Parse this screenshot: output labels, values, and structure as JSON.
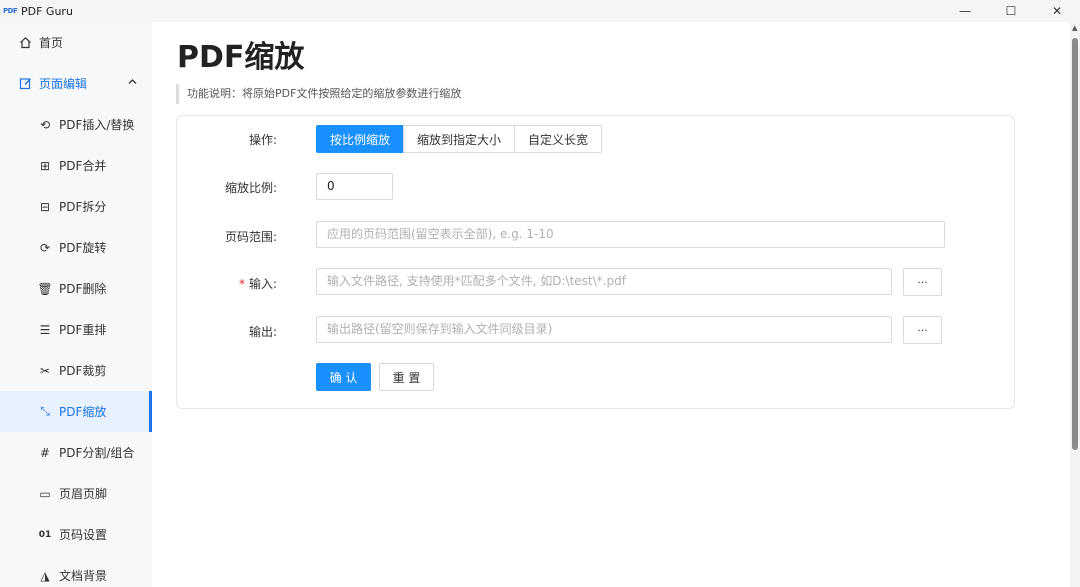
{
  "app": {
    "logo_text": "PDF",
    "title": "PDF Guru",
    "window_controls": {
      "minimize": "—",
      "maximize": "☐",
      "close": "✕"
    }
  },
  "sidebar": {
    "home": {
      "label": "首页",
      "icon": "home-icon"
    },
    "group": {
      "label": "页面编辑",
      "icon": "edit-icon",
      "expanded": true
    },
    "items": [
      {
        "label": "PDF插入/替换",
        "icon": "insert-replace-icon",
        "glyph": "⟲"
      },
      {
        "label": "PDF合并",
        "icon": "merge-icon",
        "glyph": "⊞"
      },
      {
        "label": "PDF拆分",
        "icon": "split-icon",
        "glyph": "⊟"
      },
      {
        "label": "PDF旋转",
        "icon": "rotate-icon",
        "glyph": "⟳"
      },
      {
        "label": "PDF删除",
        "icon": "trash-icon",
        "glyph": "🗑"
      },
      {
        "label": "PDF重排",
        "icon": "list-icon",
        "glyph": "☰"
      },
      {
        "label": "PDF裁剪",
        "icon": "scissors-icon",
        "glyph": "✂"
      },
      {
        "label": "PDF缩放",
        "icon": "scale-icon",
        "glyph": "⤡",
        "active": true
      },
      {
        "label": "PDF分割/组合",
        "icon": "grid-icon",
        "glyph": "#"
      },
      {
        "label": "页眉页脚",
        "icon": "header-footer-icon",
        "glyph": "▭"
      },
      {
        "label": "页码设置",
        "icon": "page-number-icon",
        "glyph": "01"
      },
      {
        "label": "文档背景",
        "icon": "background-icon",
        "glyph": "◮"
      }
    ]
  },
  "main": {
    "title": "PDF缩放",
    "description": "功能说明：将原始PDF文件按照给定的缩放参数进行缩放",
    "form": {
      "operation_label": "操作:",
      "operation_options": [
        "按比例缩放",
        "缩放到指定大小",
        "自定义长宽"
      ],
      "operation_selected": "按比例缩放",
      "ratio_label": "缩放比例:",
      "ratio_value": "0",
      "page_range_label": "页码范围:",
      "page_range_placeholder": "应用的页码范围(留空表示全部), e.g. 1-10",
      "input_label": "输入:",
      "input_required_mark": "*",
      "input_placeholder": "输入文件路径, 支持使用*匹配多个文件, 如D:\\test\\*.pdf",
      "output_label": "输出:",
      "output_placeholder": "输出路径(留空则保存到输入文件同级目录)",
      "browse_label": "···",
      "confirm_label": "确 认",
      "reset_label": "重 置"
    }
  },
  "colors": {
    "accent": "#1890ff",
    "sidebar_active_bg": "#e8f2ff",
    "sidebar_bg": "#f7f8fa",
    "required": "#f5222d"
  }
}
